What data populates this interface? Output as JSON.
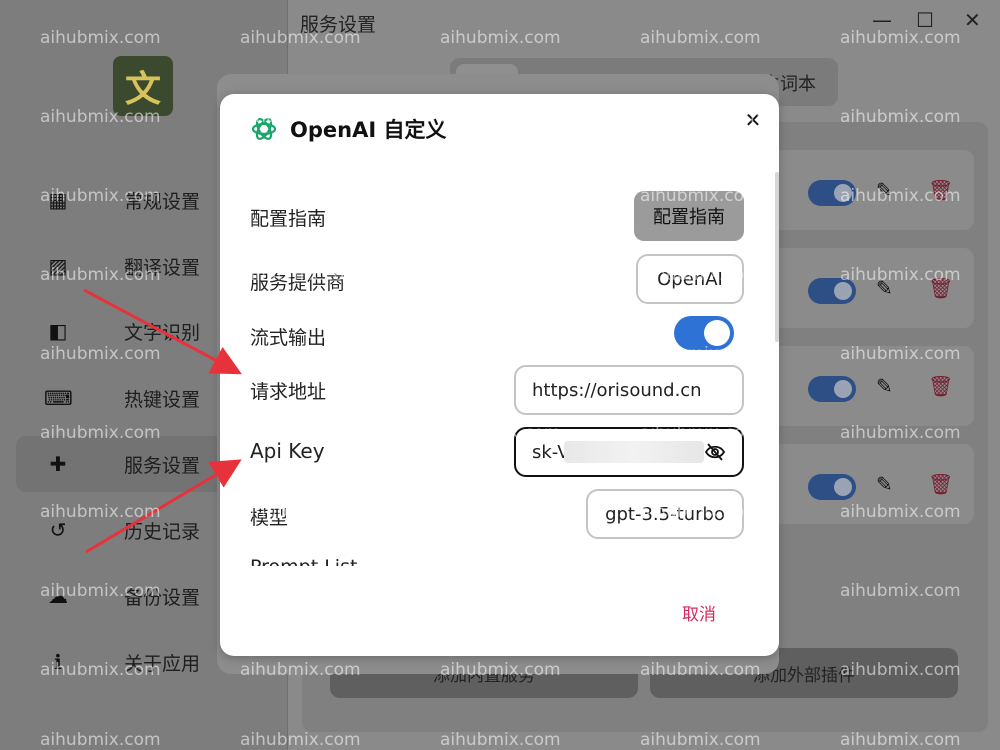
{
  "app": {
    "title": "服务设置",
    "logo_text": "文",
    "nav": [
      {
        "label": "常规设置",
        "icon": "grid-icon"
      },
      {
        "label": "翻译设置",
        "icon": "image-translate-icon"
      },
      {
        "label": "文字识别",
        "icon": "ocr-icon"
      },
      {
        "label": "热键设置",
        "icon": "keyboard-icon"
      },
      {
        "label": "服务设置",
        "icon": "puzzle-icon",
        "active": true
      },
      {
        "label": "历史记录",
        "icon": "history-icon"
      },
      {
        "label": "备份设置",
        "icon": "cloud-icon"
      },
      {
        "label": "关于应用",
        "icon": "info-icon"
      }
    ],
    "tab_label": "生词本",
    "bottom_buttons": [
      "添加内置服务",
      "添加外部插件"
    ]
  },
  "dialog": {
    "title": "OpenAI 自定义",
    "guide_label": "配置指南",
    "guide_button": "配置指南",
    "provider_label": "服务提供商",
    "provider_value": "OpenAI",
    "stream_label": "流式输出",
    "stream_enabled": true,
    "url_label": "请求地址",
    "url_value": "https://orisound.cn",
    "apikey_label": "Api Key",
    "apikey_value": "sk-Vi",
    "model_label": "模型",
    "model_value": "gpt-3.5-turbo",
    "prompt_label": "Prompt List",
    "cancel_label": "取消"
  },
  "watermark": "aihubmix.com",
  "colors": {
    "accent": "#2f72d6",
    "cancel": "#d6285c",
    "guide_button_bg": "#9b9b9b"
  }
}
